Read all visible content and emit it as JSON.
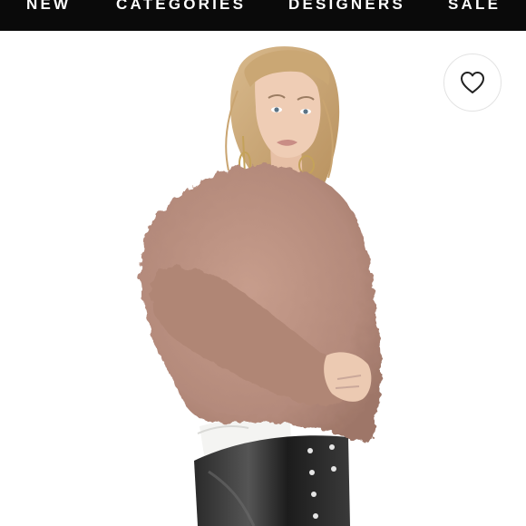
{
  "nav": {
    "items": [
      {
        "label": "NEW"
      },
      {
        "label": "CATEGORIES"
      },
      {
        "label": "DESIGNERS"
      },
      {
        "label": "SALE"
      }
    ]
  },
  "product_image": {
    "alt": "Model wearing a blush pink faux fur jacket"
  },
  "favorite": {
    "icon": "heart-outline-icon"
  },
  "colors": {
    "nav_background": "#0a0a0a",
    "nav_text": "#ffffff",
    "jacket": "#b98f80",
    "background": "#ffffff"
  }
}
